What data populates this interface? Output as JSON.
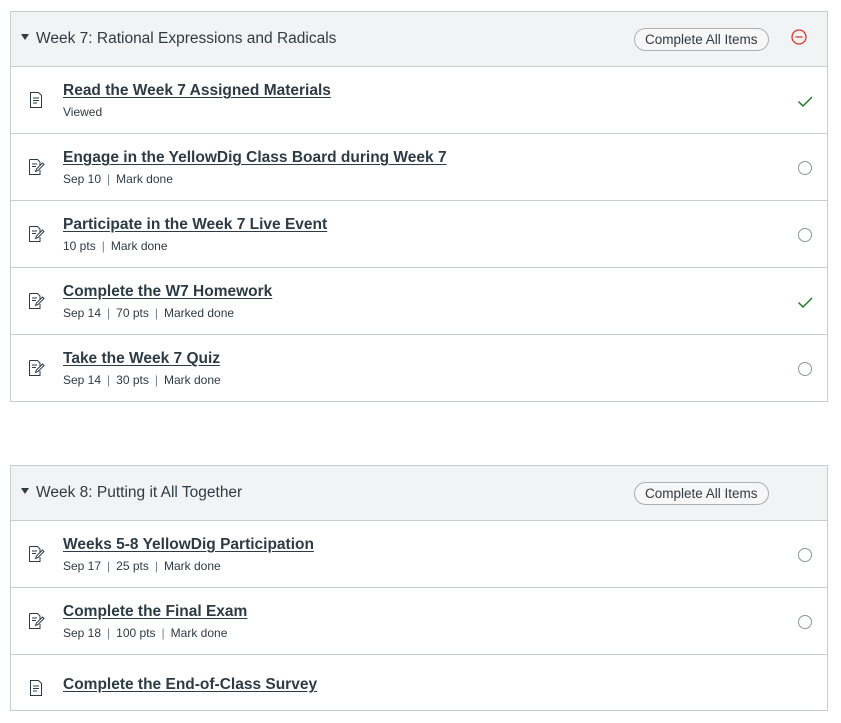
{
  "modules": [
    {
      "title": "Week 7: Rational Expressions and Radicals",
      "complete_all_label": "Complete All Items",
      "has_collapse_icon": true,
      "items": [
        {
          "title": "Read the Week 7 Assigned Materials",
          "meta": [
            "Viewed"
          ],
          "icon": "document-icon",
          "status": "check"
        },
        {
          "title": "Engage in the YellowDig Class Board during Week 7",
          "meta": [
            "Sep 10",
            "Mark done"
          ],
          "icon": "assignment-icon",
          "status": "empty"
        },
        {
          "title": "Participate in the Week 7 Live Event",
          "meta": [
            "10 pts",
            "Mark done"
          ],
          "icon": "assignment-icon",
          "status": "empty"
        },
        {
          "title": "Complete the W7 Homework",
          "meta": [
            "Sep 14",
            "70 pts",
            "Marked done"
          ],
          "icon": "assignment-icon",
          "status": "check"
        },
        {
          "title": "Take the Week 7 Quiz",
          "meta": [
            "Sep 14",
            "30 pts",
            "Mark done"
          ],
          "icon": "assignment-icon",
          "status": "empty"
        }
      ]
    },
    {
      "title": "Week 8: Putting it All Together",
      "complete_all_label": "Complete All Items",
      "has_collapse_icon": false,
      "items": [
        {
          "title": "Weeks 5-8 YellowDig Participation",
          "meta": [
            "Sep 17",
            "25 pts",
            "Mark done"
          ],
          "icon": "assignment-icon",
          "status": "empty"
        },
        {
          "title": "Complete the Final Exam",
          "meta": [
            "Sep 18",
            "100 pts",
            "Mark done"
          ],
          "icon": "assignment-icon",
          "status": "empty"
        },
        {
          "title": "Complete the End-of-Class Survey",
          "meta": [],
          "icon": "document-icon",
          "status": "none"
        }
      ]
    }
  ],
  "colors": {
    "check": "#127a1b",
    "collapse": "#d9362a",
    "text": "#2d3b45",
    "border": "#c7cdd1",
    "header_bg": "#f2f3f4"
  }
}
